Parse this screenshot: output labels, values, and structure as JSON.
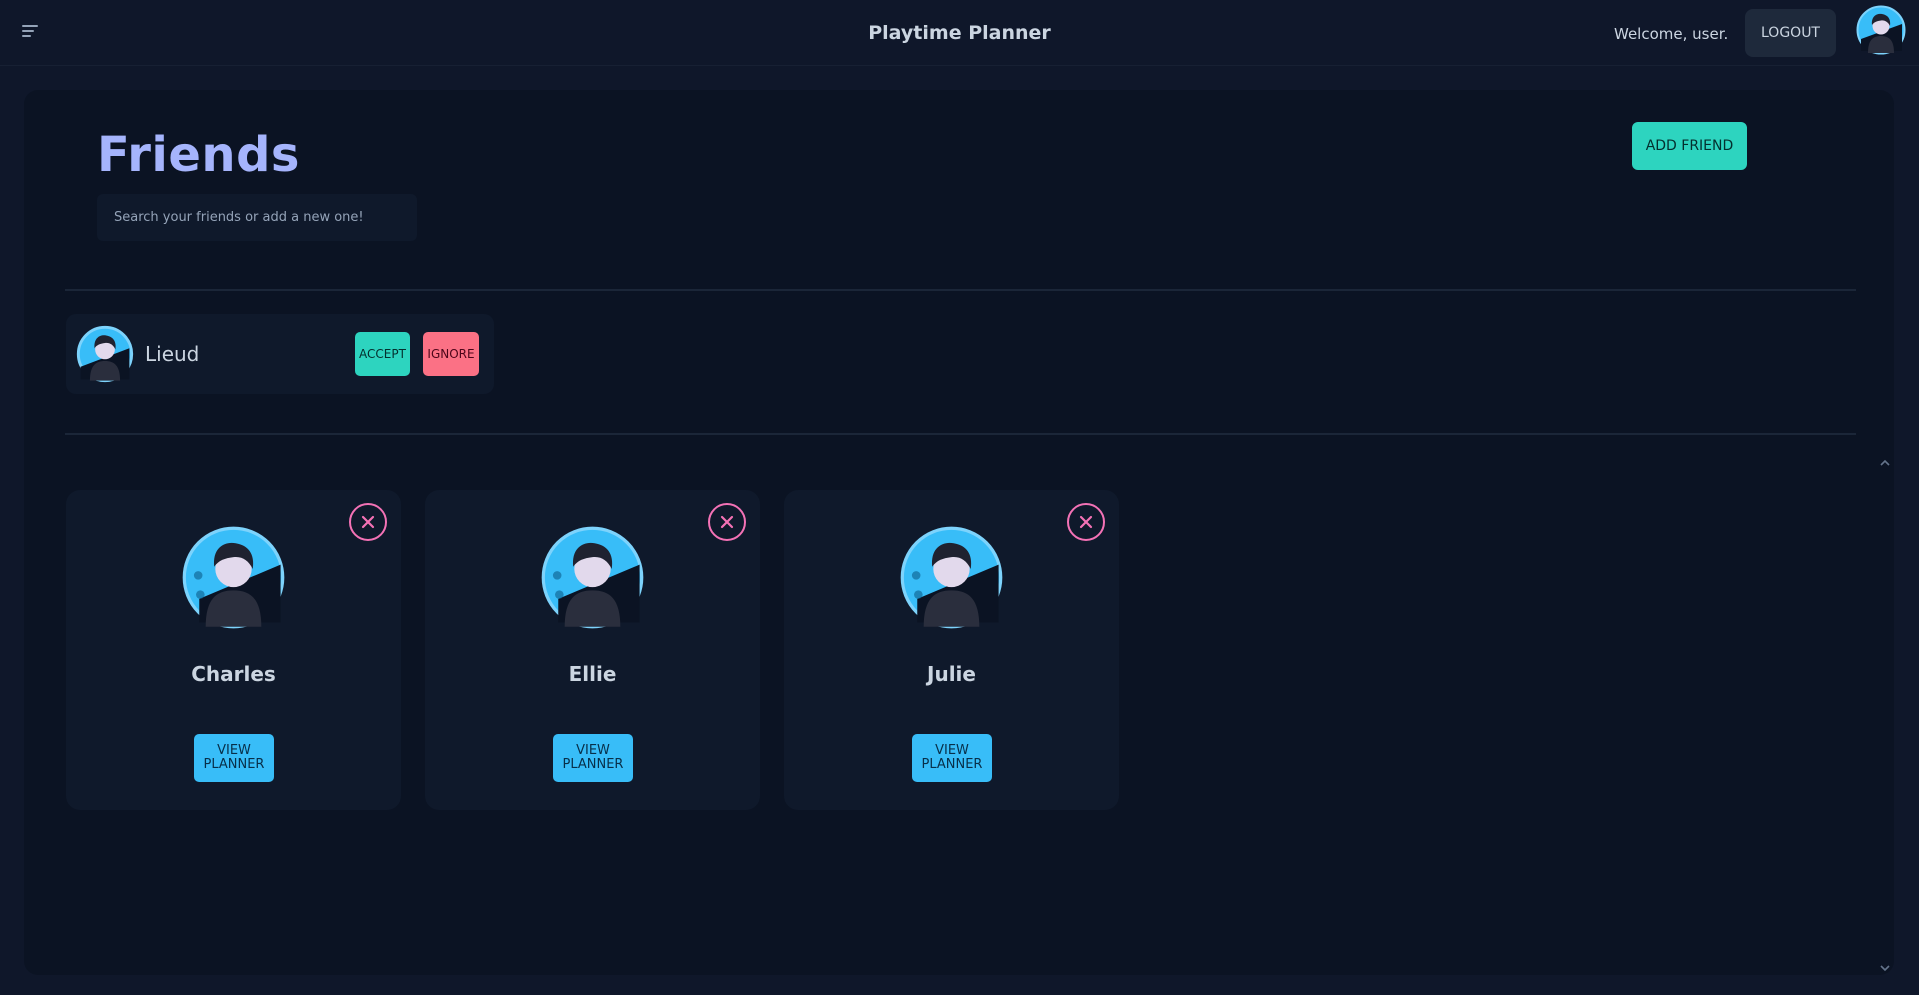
{
  "header": {
    "app_title": "Playtime Planner",
    "welcome": "Welcome, user.",
    "logout_label": "LOGOUT"
  },
  "page": {
    "title": "Friends",
    "search_placeholder": "Search your friends or add a new one!",
    "add_friend_label": "ADD FRIEND"
  },
  "requests": [
    {
      "name": "Lieud",
      "accept_label": "ACCEPT",
      "ignore_label": "IGNORE"
    }
  ],
  "friends": [
    {
      "name": "Charles",
      "button_label": "VIEW PLANNER"
    },
    {
      "name": "Ellie",
      "button_label": "VIEW PLANNER"
    },
    {
      "name": "Julie",
      "button_label": "VIEW PLANNER"
    }
  ],
  "colors": {
    "background": "#0f172a",
    "accent_teal": "#2dd4bf",
    "accent_pink": "#fb7185",
    "accent_blue": "#38bdf8",
    "heading": "#a5b4fc"
  },
  "icons": [
    "menu-icon",
    "avatar-icon",
    "close-icon",
    "chevron-up-icon",
    "chevron-down-icon"
  ]
}
